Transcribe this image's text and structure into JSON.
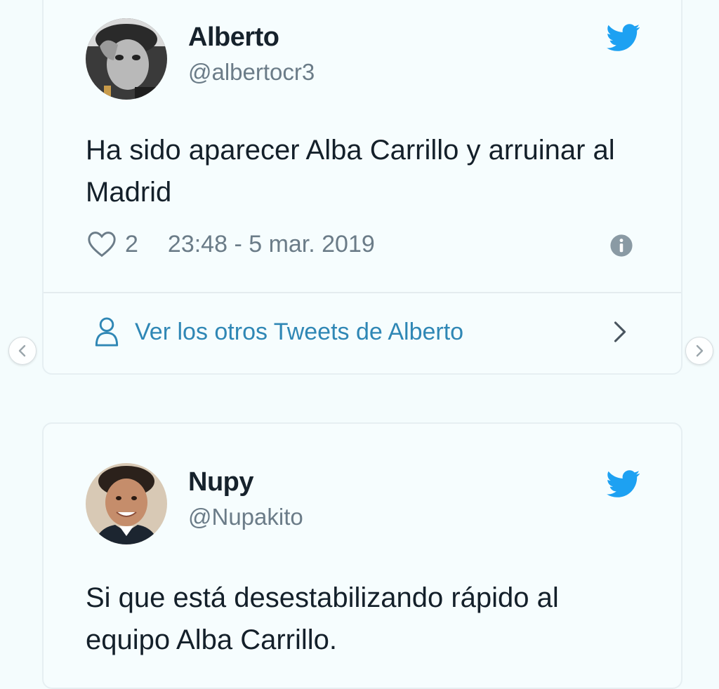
{
  "tweets": [
    {
      "name": "Alberto",
      "handle": "@albertocr3",
      "text": "Ha sido aparecer Alba Carrillo y arruinar al Madrid",
      "likes": "2",
      "timestamp": "23:48 - 5 mar. 2019",
      "more_link": "Ver los otros Tweets de Alberto",
      "icons": [
        "twitter-bird-icon",
        "heart-icon",
        "info-icon",
        "person-icon",
        "chevron-right-icon"
      ]
    },
    {
      "name": "Nupy",
      "handle": "@Nupakito",
      "text": "Si que está desestabilizando rápido al equipo Alba Carrillo.",
      "icons": [
        "twitter-bird-icon"
      ]
    }
  ],
  "carousel": {
    "prev_icon": "chevron-left-icon",
    "next_icon": "chevron-right-icon"
  },
  "colors": {
    "background": "#f4fcfd",
    "twitter_blue": "#1da1f2",
    "link_blue": "#2f87b5",
    "muted_text": "#6b7c88",
    "body_text": "#14202a"
  }
}
